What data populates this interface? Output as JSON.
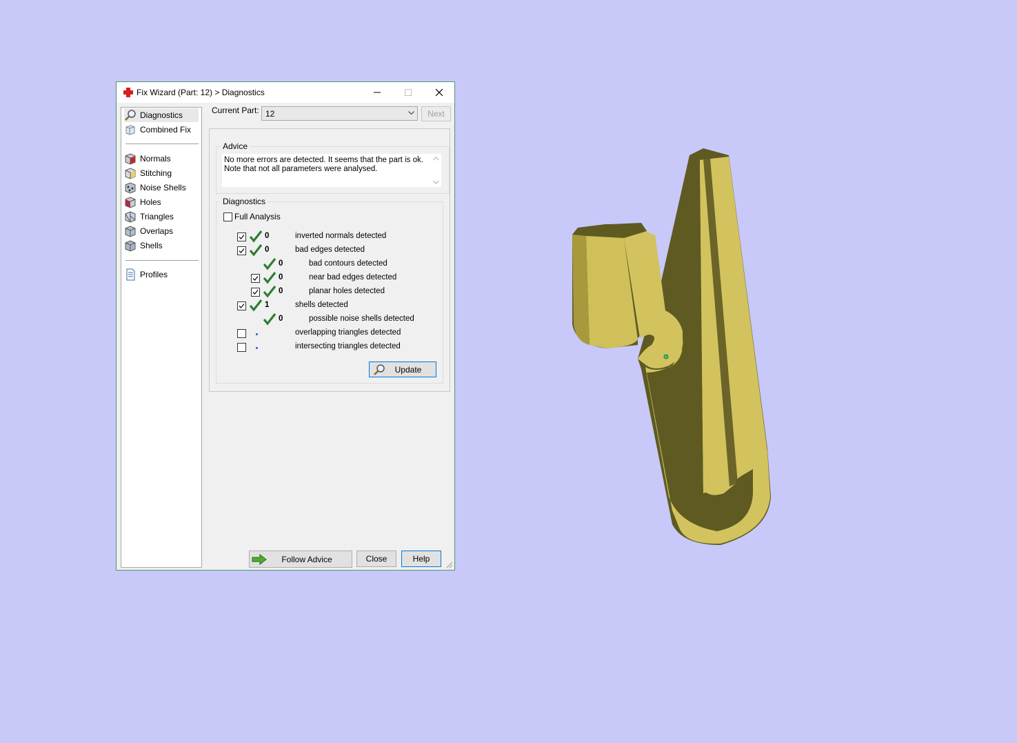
{
  "window": {
    "title": "Fix Wizard (Part: 12) > Diagnostics"
  },
  "sidebar": {
    "items": [
      {
        "label": "Diagnostics",
        "icon": "magnifier-icon",
        "selected": true
      },
      {
        "label": "Combined Fix",
        "icon": "combined-fix-icon"
      },
      {
        "label": "Normals",
        "icon": "normals-cube-icon"
      },
      {
        "label": "Stitching",
        "icon": "stitching-cube-icon"
      },
      {
        "label": "Noise Shells",
        "icon": "noise-shells-cube-icon"
      },
      {
        "label": "Holes",
        "icon": "holes-cube-icon"
      },
      {
        "label": "Triangles",
        "icon": "triangles-cube-icon"
      },
      {
        "label": "Overlaps",
        "icon": "overlaps-cube-icon"
      },
      {
        "label": "Shells",
        "icon": "shells-cube-icon"
      },
      {
        "label": "Profiles",
        "icon": "profiles-document-icon"
      }
    ]
  },
  "header": {
    "current_part_label": "Current Part:",
    "current_part_value": "12",
    "next_label": "Next"
  },
  "advice": {
    "title": "Advice",
    "text": "No more errors are detected. It seems that the part is ok. Note that not all parameters were analysed."
  },
  "diagnostics": {
    "title": "Diagnostics",
    "full_analysis_label": "Full Analysis",
    "full_analysis_checked": false,
    "rows": [
      {
        "checkbox": true,
        "checked": true,
        "status": "ok",
        "count": "0",
        "label": "inverted normals detected",
        "indent": 0
      },
      {
        "checkbox": true,
        "checked": true,
        "status": "ok",
        "count": "0",
        "label": "bad edges detected",
        "indent": 0
      },
      {
        "checkbox": false,
        "checked": false,
        "status": "ok",
        "count": "0",
        "label": "bad contours detected",
        "indent": 1
      },
      {
        "checkbox": true,
        "checked": true,
        "status": "ok",
        "count": "0",
        "label": "near bad edges detected",
        "indent": 1
      },
      {
        "checkbox": true,
        "checked": true,
        "status": "ok",
        "count": "0",
        "label": "planar holes detected",
        "indent": 1
      },
      {
        "checkbox": true,
        "checked": true,
        "status": "ok",
        "count": "1",
        "label": "shells detected",
        "indent": 0
      },
      {
        "checkbox": false,
        "checked": false,
        "status": "ok",
        "count": "0",
        "label": "possible noise shells detected",
        "indent": 1
      },
      {
        "checkbox": true,
        "checked": false,
        "status": "unknown",
        "count": "",
        "label": "overlapping triangles detected",
        "indent": 0
      },
      {
        "checkbox": true,
        "checked": false,
        "status": "unknown",
        "count": "",
        "label": "intersecting triangles detected",
        "indent": 0
      }
    ],
    "update_label": "Update"
  },
  "footer": {
    "follow_advice_label": "Follow Advice",
    "close_label": "Close",
    "help_label": "Help"
  },
  "colors": {
    "background": "#c8c8f9",
    "model_face": "#d2c35e",
    "model_side": "#5e5a22",
    "check_green": "#2e7d32"
  }
}
